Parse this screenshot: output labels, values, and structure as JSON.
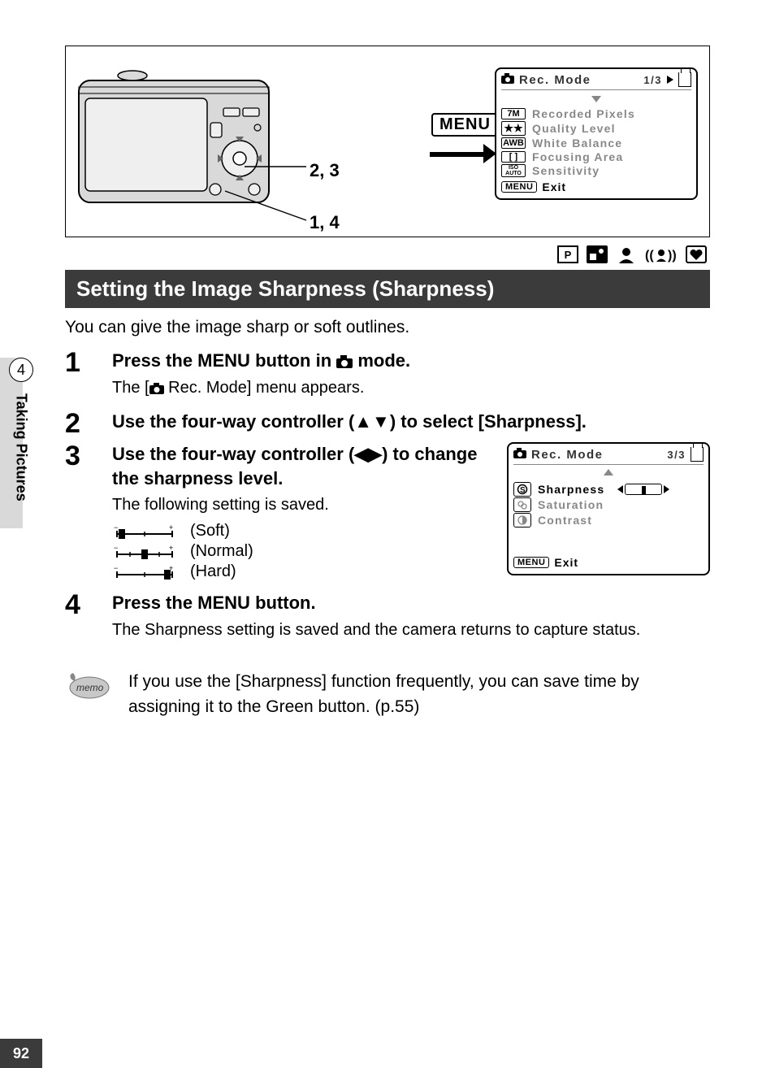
{
  "page_number": "92",
  "side": {
    "chapter_num": "4",
    "chapter_label": "Taking Pictures"
  },
  "diagram": {
    "callout_a": "2, 3",
    "callout_b": "1, 4",
    "menu_label": "MENU"
  },
  "screen1": {
    "title": "Rec. Mode",
    "page": "1/3",
    "items": [
      {
        "icon": "7M",
        "label": "Recorded Pixels"
      },
      {
        "icon": "★★",
        "label": "Quality Level"
      },
      {
        "icon": "AWB",
        "label": "White Balance"
      },
      {
        "icon": "[ ]",
        "label": "Focusing Area"
      },
      {
        "icon": "ISO AUTO",
        "label": "Sensitivity"
      }
    ],
    "exit_chip": "MENU",
    "exit_label": "Exit"
  },
  "mode_icons": [
    "P",
    "night",
    "portrait",
    "stabilize",
    "heart"
  ],
  "section_title": "Setting the Image Sharpness (Sharpness)",
  "intro": "You can give the image sharp or soft outlines.",
  "steps": {
    "s1": {
      "num": "1",
      "title_pre": "Press the ",
      "title_menu": "MENU",
      "title_mid": " button in ",
      "title_post": " mode.",
      "sub": "The [",
      "sub2": " Rec. Mode] menu appears."
    },
    "s2": {
      "num": "2",
      "title": "Use the four-way controller (▲▼) to select [Sharpness]."
    },
    "s3": {
      "num": "3",
      "title": "Use the four-way controller (◀▶) to change the sharpness level.",
      "sub": "The following setting is saved.",
      "levels": [
        {
          "label": "(Soft)"
        },
        {
          "label": "(Normal)"
        },
        {
          "label": "(Hard)"
        }
      ]
    },
    "s4": {
      "num": "4",
      "title_pre": "Press the ",
      "title_menu": "MENU",
      "title_post": " button.",
      "sub": "The Sharpness setting is saved and the camera returns to capture status."
    }
  },
  "screen2": {
    "title": "Rec. Mode",
    "page": "3/3",
    "items": [
      {
        "label": "Sharpness",
        "active": true
      },
      {
        "label": "Saturation",
        "active": false
      },
      {
        "label": "Contrast",
        "active": false
      }
    ],
    "exit_chip": "MENU",
    "exit_label": "Exit"
  },
  "memo": {
    "icon_label": "memo",
    "text": "If you use the [Sharpness] function frequently, you can save time by assigning it to the Green button. (p.55)"
  }
}
